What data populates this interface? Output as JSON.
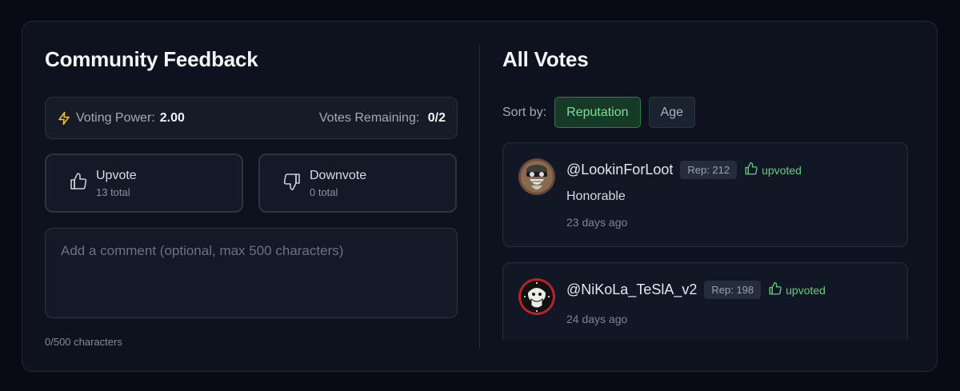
{
  "feedback": {
    "title": "Community Feedback",
    "voting_power_label": "Voting Power:",
    "voting_power_value": "2.00",
    "votes_remaining_label": "Votes Remaining:",
    "votes_remaining_value": "0/2",
    "upvote": {
      "label": "Upvote",
      "count": "13 total",
      "icon": "thumbs-up-icon"
    },
    "downvote": {
      "label": "Downvote",
      "count": "0 total",
      "icon": "thumbs-down-icon"
    },
    "comment_placeholder": "Add a comment (optional, max 500 characters)",
    "comment_value": "",
    "char_count": "0/500 characters",
    "accent_color": "#f2c433"
  },
  "votes": {
    "title": "All Votes",
    "sort_label": "Sort by:",
    "sort_options": [
      "Reputation",
      "Age"
    ],
    "sort_selected": "Reputation",
    "items": [
      {
        "username": "@LookinForLoot",
        "rep": "Rep: 212",
        "status": "upvoted",
        "comment": "Honorable",
        "time": "23 days ago"
      },
      {
        "username": "@NiKoLa_TeSlA_v2",
        "rep": "Rep: 198",
        "status": "upvoted",
        "comment": "",
        "time": "24 days ago"
      }
    ],
    "status_color": "#5fcf7d"
  }
}
